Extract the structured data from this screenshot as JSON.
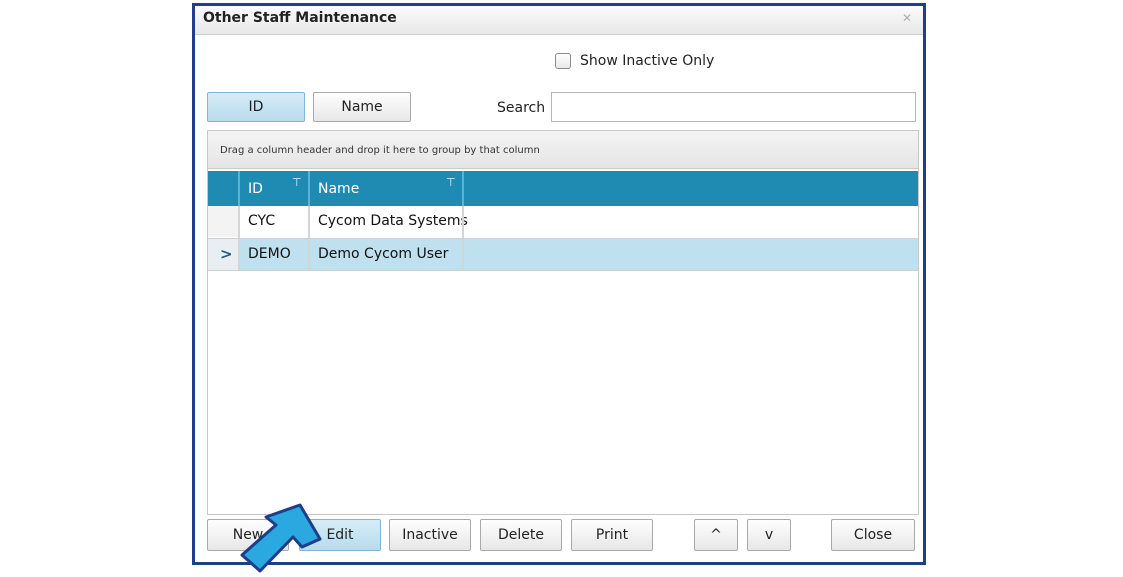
{
  "window": {
    "title": "Other Staff Maintenance"
  },
  "filters": {
    "show_inactive_label": "Show Inactive Only"
  },
  "sort_buttons": [
    {
      "label": "ID",
      "active": true
    },
    {
      "label": "Name",
      "active": false
    }
  ],
  "search": {
    "label": "Search",
    "value": ""
  },
  "grid": {
    "group_hint": "Drag a column header and drop it here to group by that column",
    "columns": [
      "ID",
      "Name"
    ],
    "rows": [
      {
        "id": "CYC",
        "name": "Cycom Data Systems",
        "selected": false
      },
      {
        "id": "DEMO",
        "name": "Demo Cycom User",
        "selected": true
      }
    ],
    "current_row_indicator": ">"
  },
  "footer_buttons": {
    "new": "New",
    "edit": "Edit",
    "inactive": "Inactive",
    "delete": "Delete",
    "print": "Print",
    "move_up": "^",
    "move_down": "v",
    "close": "Close"
  },
  "colors": {
    "header_blue": "#1f8bb3",
    "selected_row": "#bfe0ef",
    "window_border": "#1f3f86",
    "arrow": "#29a9df"
  }
}
